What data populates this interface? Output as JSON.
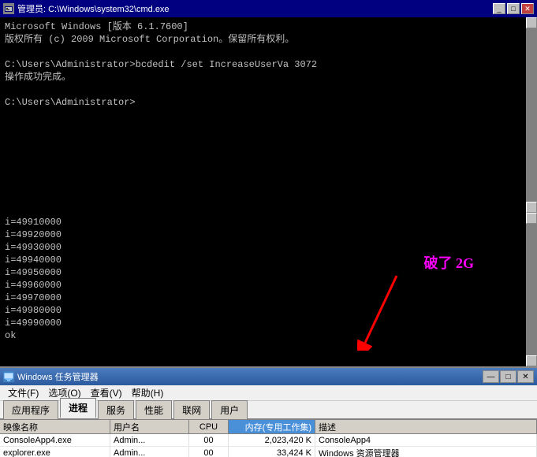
{
  "cmd_window": {
    "title": "管理员: C:\\Windows\\system32\\cmd.exe",
    "content_lines": [
      "Microsoft Windows [版本 6.1.7600]",
      "版权所有 (c) 2009 Microsoft Corporation。保留所有权利。",
      "",
      "C:\\Users\\Administrator>bcdedit /set IncreaseUserVa 3072",
      "操作成功完成。",
      "",
      "C:\\Users\\Administrator>"
    ],
    "minimize_label": "_",
    "restore_label": "□",
    "close_label": "✕"
  },
  "cmd_output": {
    "lines": [
      "i=49910000",
      "i=49920000",
      "i=49930000",
      "i=49940000",
      "i=49950000",
      "i=49960000",
      "i=49970000",
      "i=49980000",
      "i=49990000",
      "ok"
    ],
    "annotation": "破了 2G"
  },
  "taskmgr": {
    "title": "Windows 任务管理器",
    "menu": [
      "文件(F)",
      "选项(O)",
      "查看(V)",
      "帮助(H)"
    ],
    "tabs": [
      "应用程序",
      "进程",
      "服务",
      "性能",
      "联网",
      "用户"
    ],
    "active_tab": "进程",
    "columns": [
      "映像名称",
      "用户名",
      "CPU",
      "内存(专用工作集)",
      "描述"
    ],
    "rows": [
      {
        "name": "ConsoleApp4.exe",
        "user": "Admin...",
        "cpu": "00",
        "memory": "2,023,420 K",
        "desc": "ConsoleApp4"
      },
      {
        "name": "explorer.exe",
        "user": "Admin...",
        "cpu": "00",
        "memory": "33,424 K",
        "desc": "Windows 资源管理器"
      }
    ],
    "minimize_label": "—",
    "restore_label": "□",
    "close_label": "✕"
  }
}
